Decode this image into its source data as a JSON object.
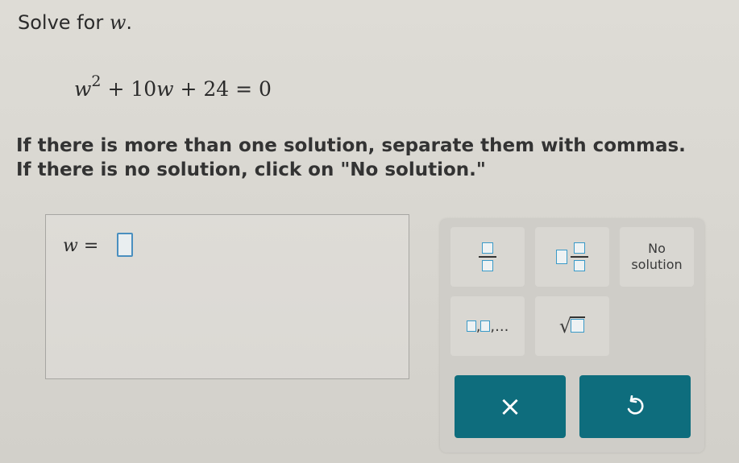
{
  "prompt": {
    "text": "Solve for ",
    "variable": "w",
    "period": "."
  },
  "equation": {
    "var1": "w",
    "exp": "2",
    "term2": " + 10",
    "var2": "w",
    "rest": " + 24 = 0"
  },
  "instructions": {
    "line1": "If there is more than one solution, separate them with commas.",
    "line2": "If there is no solution, click on \"No solution.\""
  },
  "answer": {
    "variable": "w",
    "equals": " =",
    "value": ""
  },
  "keypad": {
    "no_solution_line1": "No",
    "no_solution_line2": "solution",
    "list_suffix": ",...",
    "sqrt_symbol": "√",
    "clear_symbol": "×"
  },
  "colors": {
    "accent_button": "#0e6d7d",
    "input_border": "#4a8fbf",
    "keypad_bg": "#cfcdc8"
  }
}
